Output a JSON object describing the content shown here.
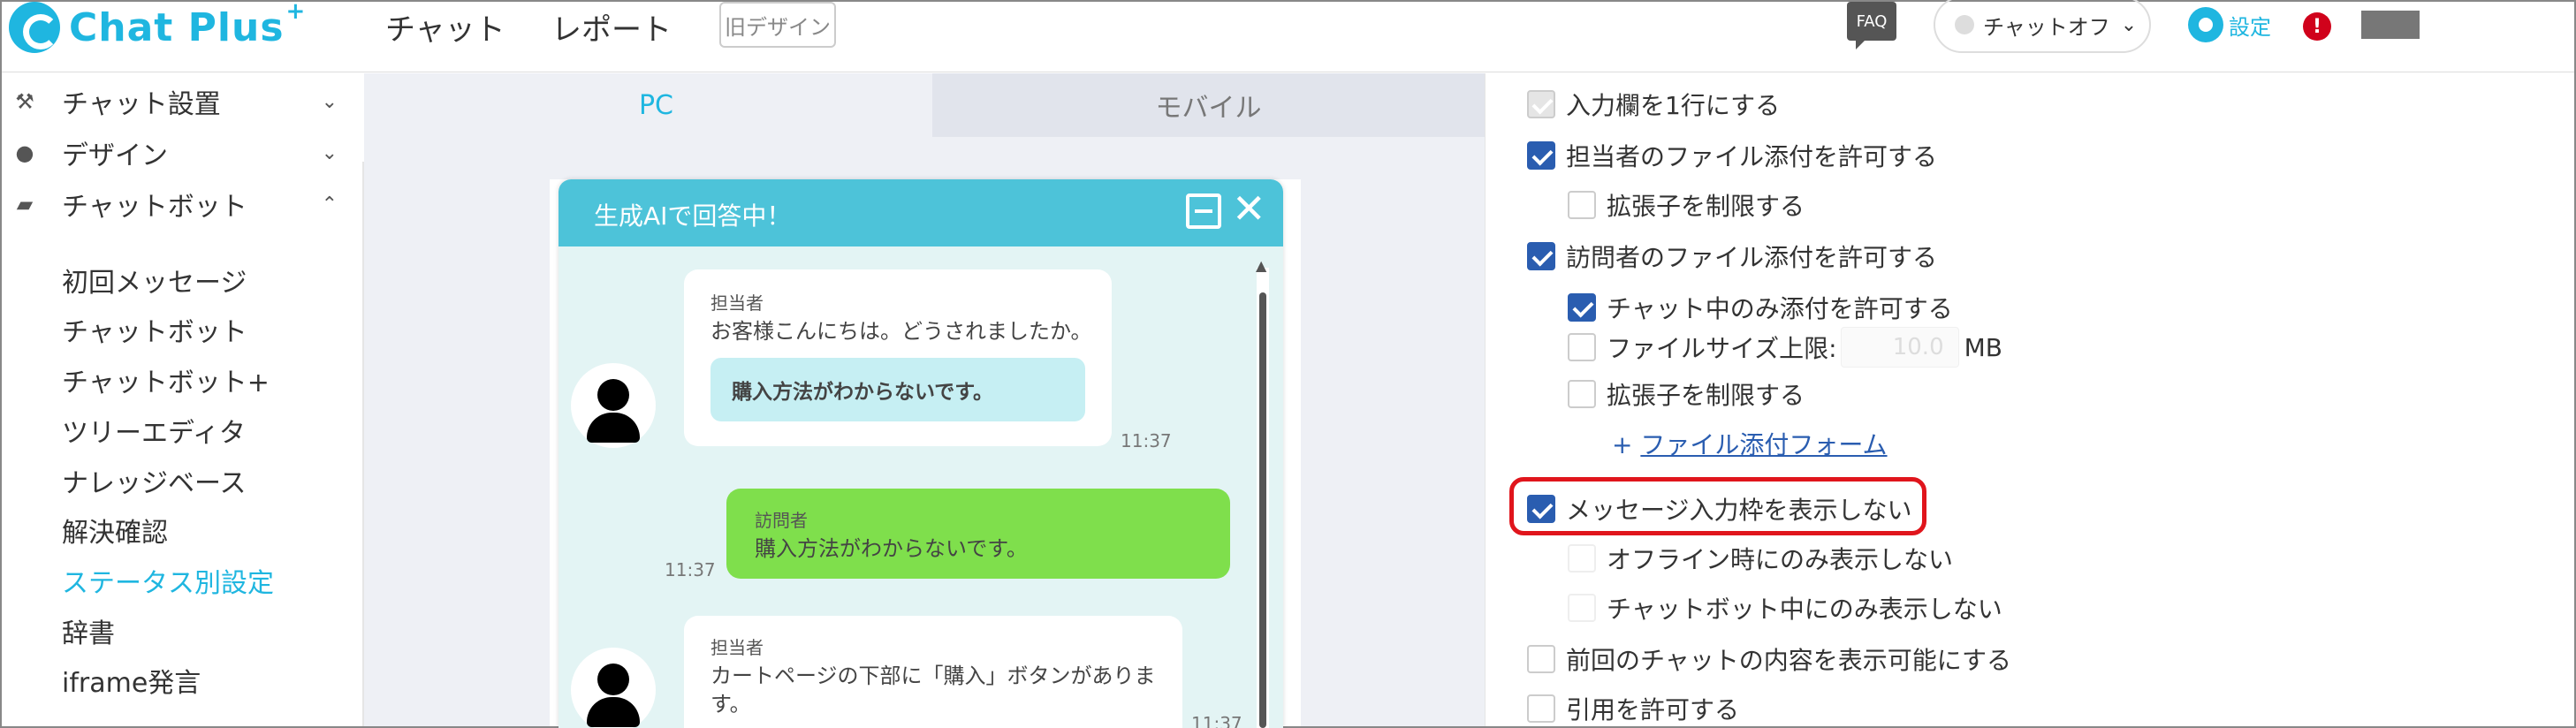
{
  "header": {
    "logo_text": "Chat Plus",
    "logo_plus": "+",
    "nav": [
      "チャット",
      "レポート"
    ],
    "old_design": "旧デザイン",
    "faq": "FAQ",
    "status": "チャットオフ",
    "settings": "設定",
    "alert": "!"
  },
  "sidebar": {
    "sections": [
      {
        "label": "チャット設置",
        "icon": "tools-icon"
      },
      {
        "label": "デザイン",
        "icon": "palette-icon"
      },
      {
        "label": "チャットボット",
        "icon": "chat-bubble-icon"
      }
    ],
    "items": [
      {
        "label": "初回メッセージ"
      },
      {
        "label": "チャットボット"
      },
      {
        "label": "チャットボット+"
      },
      {
        "label": "ツリーエディタ"
      },
      {
        "label": "ナレッジベース"
      },
      {
        "label": "解決確認"
      },
      {
        "label": "ステータス別設定",
        "active": true
      },
      {
        "label": "辞書"
      },
      {
        "label": "iframe発言"
      }
    ]
  },
  "preview": {
    "tabs": [
      "PC",
      "モバイル"
    ],
    "widget_title": "生成AIで回答中！",
    "messages": [
      {
        "sender": "担当者",
        "text": "お客様こんにちは。どうされましたか。",
        "button": "購入方法がわからないです。",
        "time": "11:37"
      },
      {
        "sender": "訪問者",
        "text": "購入方法がわからないです。",
        "time": "11:37"
      },
      {
        "sender": "担当者",
        "text_lines": [
          "カートページの下部に「購入」ボタンがありま",
          "す。"
        ],
        "time": "11:37"
      }
    ]
  },
  "options": {
    "single_line": "入力欄を1行にする",
    "agent_attach": "担当者のファイル添付を許可する",
    "agent_ext": "拡張子を制限する",
    "visitor_attach": "訪問者のファイル添付を許可する",
    "chat_only": "チャット中のみ添付を許可する",
    "size_limit": "ファイルサイズ上限:",
    "size_value": "10.0",
    "size_unit": "MB",
    "visitor_ext": "拡張子を制限する",
    "attach_form": "ファイル添付フォーム",
    "hide_input": "メッセージ入力枠を表示しない",
    "offline_only": "オフライン時にのみ表示しない",
    "bot_only": "チャットボット中にのみ表示しない",
    "prev_chat": "前回のチャットの内容を表示可能にする",
    "quote": "引用を許可する"
  }
}
